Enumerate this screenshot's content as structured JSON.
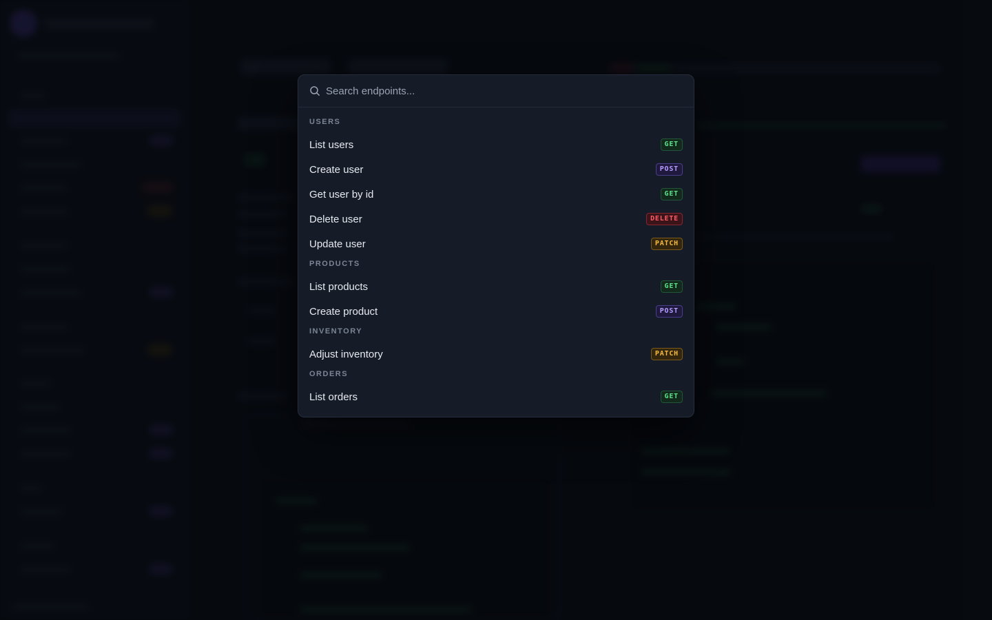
{
  "search": {
    "placeholder": "Search endpoints..."
  },
  "groups": [
    {
      "label": "USERS",
      "items": [
        {
          "label": "List users",
          "method": "GET"
        },
        {
          "label": "Create user",
          "method": "POST"
        },
        {
          "label": "Get user by id",
          "method": "GET"
        },
        {
          "label": "Delete user",
          "method": "DELETE"
        },
        {
          "label": "Update user",
          "method": "PATCH"
        }
      ]
    },
    {
      "label": "PRODUCTS",
      "items": [
        {
          "label": "List products",
          "method": "GET"
        },
        {
          "label": "Create product",
          "method": "POST"
        }
      ]
    },
    {
      "label": "INVENTORY",
      "items": [
        {
          "label": "Adjust inventory",
          "method": "PATCH"
        }
      ]
    },
    {
      "label": "ORDERS",
      "items": [
        {
          "label": "List orders",
          "method": "GET"
        }
      ]
    }
  ],
  "colors": {
    "get": "#5ee08a",
    "post": "#b69cff",
    "delete": "#ff5a65",
    "patch": "#f5b840",
    "palette_bg": "#151b27",
    "accent": "#6b4fd8"
  }
}
